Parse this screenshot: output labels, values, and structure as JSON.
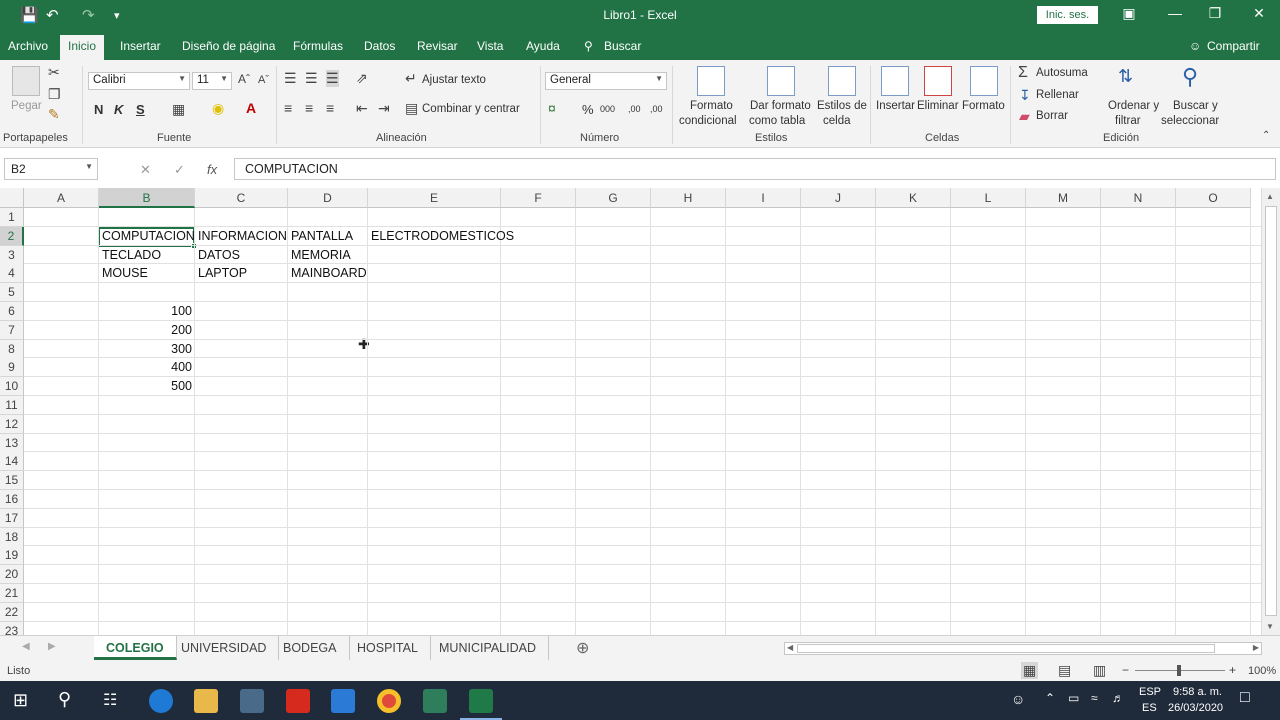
{
  "window": {
    "title": "Libro1  -  Excel",
    "signin": "Inic. ses."
  },
  "menu": {
    "tabs": [
      "Archivo",
      "Inicio",
      "Insertar",
      "Diseño de página",
      "Fórmulas",
      "Datos",
      "Revisar",
      "Vista",
      "Ayuda"
    ],
    "search": "Buscar",
    "share": "Compartir"
  },
  "ribbon": {
    "clipboard": {
      "paste": "Pegar",
      "group": "Portapapeles"
    },
    "font": {
      "name": "Calibri",
      "size": "11",
      "bold": "N",
      "italic": "K",
      "underline": "S",
      "group": "Fuente"
    },
    "alignment": {
      "wrap": "Ajustar texto",
      "merge": "Combinar y centrar",
      "group": "Alineación"
    },
    "number": {
      "format": "General",
      "percent": "%",
      "thousands": "000",
      "dec_inc": ",00",
      "dec_dec": ",00",
      "group": "Número"
    },
    "styles": {
      "cond1": "Formato",
      "cond2": "condicional",
      "table1": "Dar formato",
      "table2": "como tabla",
      "cell1": "Estilos de",
      "cell2": "celda",
      "group": "Estilos"
    },
    "cells": {
      "insert": "Insertar",
      "delete": "Eliminar",
      "format": "Formato",
      "group": "Celdas"
    },
    "editing": {
      "autosum": "Autosuma",
      "fill": "Rellenar",
      "clear": "Borrar",
      "sort1": "Ordenar y",
      "sort2": "filtrar",
      "find1": "Buscar y",
      "find2": "seleccionar",
      "group": "Edición"
    }
  },
  "formula_bar": {
    "name_box": "B2",
    "fx": "fx",
    "content": "COMPUTACION"
  },
  "columns": [
    "A",
    "B",
    "C",
    "D",
    "E",
    "F",
    "G",
    "H",
    "I",
    "J",
    "K",
    "L",
    "M",
    "N",
    "O"
  ],
  "rows": [
    "1",
    "2",
    "3",
    "4",
    "5",
    "6",
    "7",
    "8",
    "9",
    "10",
    "11",
    "12",
    "13",
    "14",
    "15",
    "16",
    "17",
    "18",
    "19",
    "20",
    "21",
    "22",
    "23"
  ],
  "cells": {
    "B2": "COMPUTACION",
    "C2": "INFORMACION",
    "D2": "PANTALLA",
    "E2": "ELECTRODOMESTICOS",
    "B3": "TECLADO",
    "C3": "DATOS",
    "D3": "MEMORIA",
    "B4": "MOUSE",
    "C4": "LAPTOP",
    "D4": "MAINBOARD",
    "B6": "100",
    "B7": "200",
    "B8": "300",
    "B9": "400",
    "B10": "500"
  },
  "sheets": [
    "COLEGIO",
    "UNIVERSIDAD",
    "BODEGA",
    "HOSPITAL",
    "MUNICIPALIDAD"
  ],
  "status": {
    "text": "Listo",
    "zoom": "100%"
  },
  "tray": {
    "lang1": "ESP",
    "lang2": "ES",
    "time": "9:58 a. m.",
    "date": "26/03/2020"
  },
  "colors": {
    "excel_green": "#217346",
    "taskbar": "#1f2a3a"
  }
}
